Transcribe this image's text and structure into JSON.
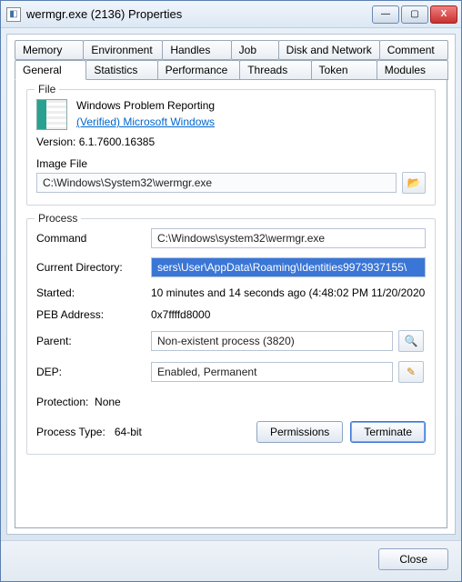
{
  "window": {
    "title": "wermgr.exe (2136) Properties",
    "buttons": {
      "min": "—",
      "max": "▢",
      "close": "X"
    }
  },
  "tabs": {
    "row_top": [
      "Memory",
      "Environment",
      "Handles",
      "Job",
      "Disk and Network",
      "Comment"
    ],
    "row_bottom": [
      "General",
      "Statistics",
      "Performance",
      "Threads",
      "Token",
      "Modules"
    ],
    "active": "General"
  },
  "file": {
    "legend": "File",
    "product_name": "Windows Problem Reporting",
    "verified_text": "(Verified) Microsoft Windows",
    "version_label": "Version:",
    "version_value": "6.1.7600.16385",
    "imagefile_label": "Image File",
    "imagefile_value": "C:\\Windows\\System32\\wermgr.exe"
  },
  "process": {
    "legend": "Process",
    "command_label": "Command",
    "command_value": "C:\\Windows\\system32\\wermgr.exe",
    "cwd_label": "Current Directory:",
    "cwd_value": "sers\\User\\AppData\\Roaming\\Identities9973937155\\",
    "started_label": "Started:",
    "started_value": "10 minutes and 14 seconds ago (4:48:02 PM 11/20/2020",
    "peb_label": "PEB Address:",
    "peb_value": "0x7ffffd8000",
    "parent_label": "Parent:",
    "parent_value": "Non-existent process (3820)",
    "dep_label": "DEP:",
    "dep_value": "Enabled, Permanent",
    "protection_label": "Protection:",
    "protection_value": "None",
    "ptype_label": "Process Type:",
    "ptype_value": "64-bit",
    "permissions_btn": "Permissions",
    "terminate_btn": "Terminate"
  },
  "footer": {
    "close_btn": "Close"
  },
  "icons": {
    "folder": "📂",
    "magnifier": "🔍",
    "pencil": "✎"
  }
}
